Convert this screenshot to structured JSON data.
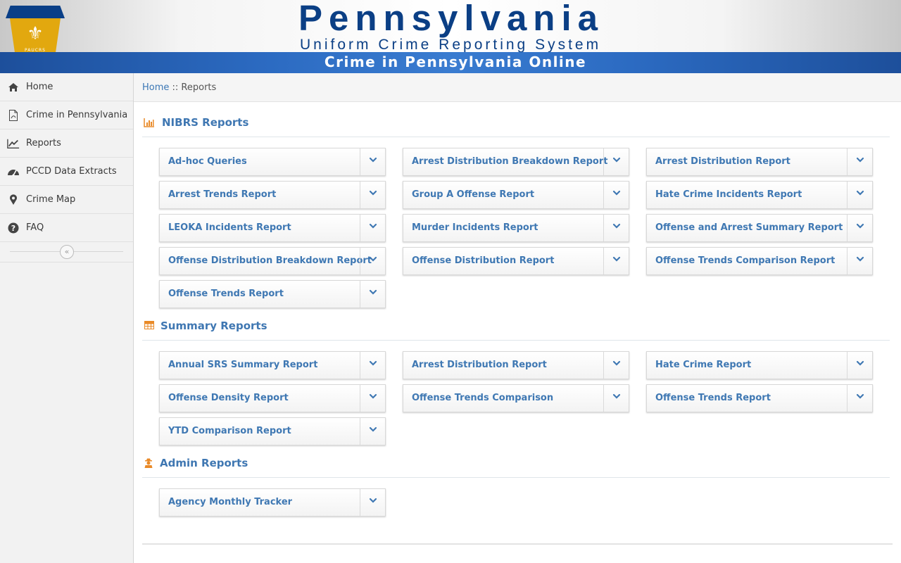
{
  "header": {
    "logo_text": "PAUCRS",
    "title": "Pennsylvania",
    "subtitle": "Uniform Crime Reporting System",
    "band": "Crime in Pennsylvania Online"
  },
  "sidebar": {
    "items": [
      {
        "label": "Home",
        "icon": "home-icon"
      },
      {
        "label": "Crime in Pennsylvania",
        "icon": "pdf-icon"
      },
      {
        "label": "Reports",
        "icon": "line-chart-icon"
      },
      {
        "label": "PCCD Data Extracts",
        "icon": "dashboard-icon"
      },
      {
        "label": "Crime Map",
        "icon": "map-marker-icon"
      },
      {
        "label": "FAQ",
        "icon": "question-circle-icon"
      }
    ],
    "collapse_icon": "double-chevron-left-icon"
  },
  "breadcrumb": {
    "home": "Home",
    "separator": " :: ",
    "current": "Reports"
  },
  "sections": {
    "nibrs": {
      "title": "NIBRS Reports",
      "icon": "bar-chart-icon",
      "reports": [
        "Ad-hoc Queries",
        "Arrest Distribution Breakdown Report",
        "Arrest Distribution Report",
        "Arrest Trends Report",
        "Group A Offense Report",
        "Hate Crime Incidents Report",
        "LEOKA Incidents Report",
        "Murder Incidents Report",
        "Offense and Arrest Summary Report",
        "Offense Distribution Breakdown Report",
        "Offense Distribution Report",
        "Offense Trends Comparison Report",
        "Offense Trends Report"
      ]
    },
    "summary": {
      "title": "Summary Reports",
      "icon": "table-icon",
      "reports": [
        "Annual SRS Summary Report",
        "Arrest Distribution Report",
        "Hate Crime Report",
        "Offense Density Report",
        "Offense Trends Comparison",
        "Offense Trends Report",
        "YTD Comparison Report"
      ]
    },
    "admin": {
      "title": "Admin Reports",
      "icon": "user-secret-icon",
      "reports": [
        "Agency Monthly Tracker"
      ]
    }
  },
  "colors": {
    "accent_blue": "#3f78b3",
    "header_blue": "#0b3f85",
    "band_blue": "#2c6bc2",
    "section_icon_orange": "#e98a28",
    "logo_gold": "#e2a80f"
  }
}
